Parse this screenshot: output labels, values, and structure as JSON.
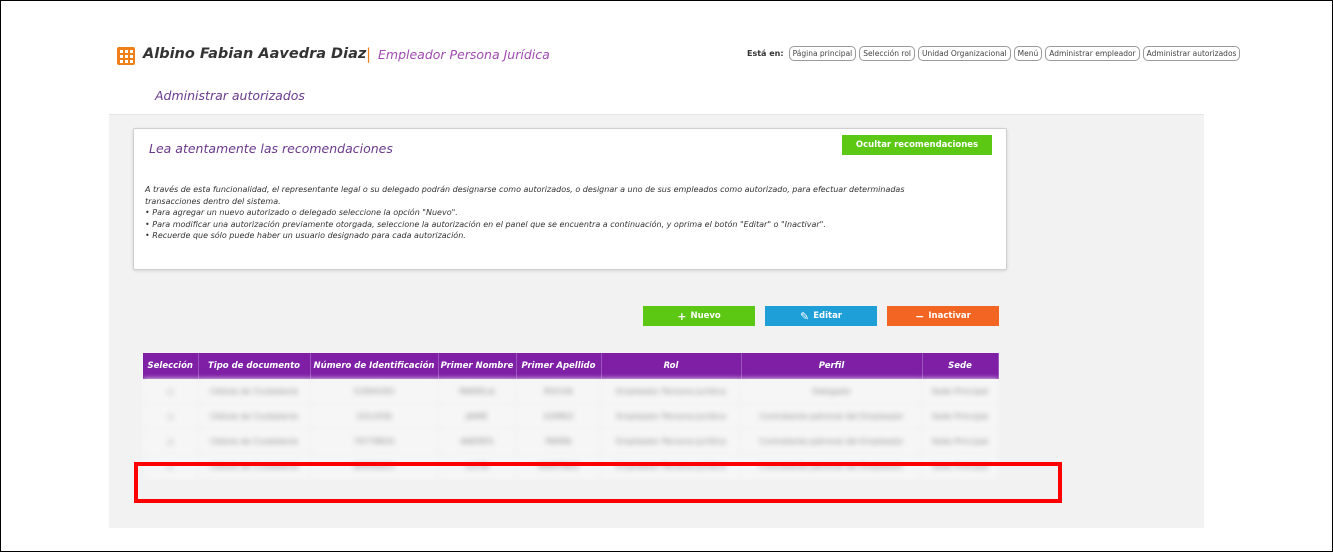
{
  "header": {
    "user_name": "Albino Fabian Aavedra Diaz",
    "separator": "|",
    "user_role": "Empleador Persona Jurídica",
    "breadcrumb_label": "Está en:",
    "breadcrumbs": [
      "Página principal",
      "Selección rol",
      "Unidad Organizacional",
      "Menú",
      "Administrar empleador",
      "Administrar autorizados"
    ]
  },
  "page": {
    "title": "Administrar autorizados"
  },
  "recommendations": {
    "title": "Lea atentamente las recomendaciones",
    "hide_label": "Ocultar recomendaciones",
    "lines": [
      "A través de esta funcionalidad, el representante legal o su delegado podrán designarse como autorizados, o designar a uno de sus empleados como autorizado, para efectuar determinadas",
      "transacciones dentro del sistema.",
      "• Para agregar un nuevo autorizado o delegado seleccione la opción \"Nuevo\".",
      "• Para modificar una autorización previamente otorgada, seleccione la autorización en el panel que se encuentra a continuación, y oprima el botón \"Editar\" o \"Inactivar\".",
      "• Recuerde que sólo puede haber un usuario designado para cada autorización."
    ]
  },
  "actions": {
    "new_label": "Nuevo",
    "edit_label": "Editar",
    "inactivate_label": "Inactivar",
    "new_icon": "plus-icon",
    "edit_icon": "pencil-icon",
    "inactivate_icon": "minus-icon"
  },
  "table": {
    "columns": [
      "Selección",
      "Tipo de documento",
      "Número de Identificación",
      "Primer Nombre",
      "Primer Apellido",
      "Rol",
      "Perfil",
      "Sede"
    ],
    "rows": [
      [
        "○",
        "Cédula de Ciudadanía",
        "52904183",
        "MARIELA",
        "ROCHA",
        "Empleador Persona Jurídica",
        "Delegado",
        "Sede Principal"
      ],
      [
        "○",
        "Cédula de Ciudadanía",
        "1012456",
        "JAIME",
        "GÓMEZ",
        "Empleador Persona Jurídica",
        "Contratante patronal del Empleador",
        "Sede Principal"
      ],
      [
        "○",
        "Cédula de Ciudadanía",
        "79778820",
        "ANDRÉS",
        "PARRA",
        "Empleador Persona Jurídica",
        "Contratante patronal del Empleador",
        "Sede Principal"
      ],
      [
        "○",
        "Cédula de Ciudadanía",
        "80456923",
        "LUCÍA",
        "MARTÍNEZ",
        "Empleador Persona Jurídica",
        "Contratante patronal del Empleador",
        "Sede Principal"
      ]
    ]
  },
  "colors": {
    "brand_purple": "#7e1fa6",
    "title_purple": "#6b3a8c",
    "green": "#5cc814",
    "blue": "#1e9fd8",
    "orange": "#f26522",
    "highlight_red": "#ff0000"
  }
}
